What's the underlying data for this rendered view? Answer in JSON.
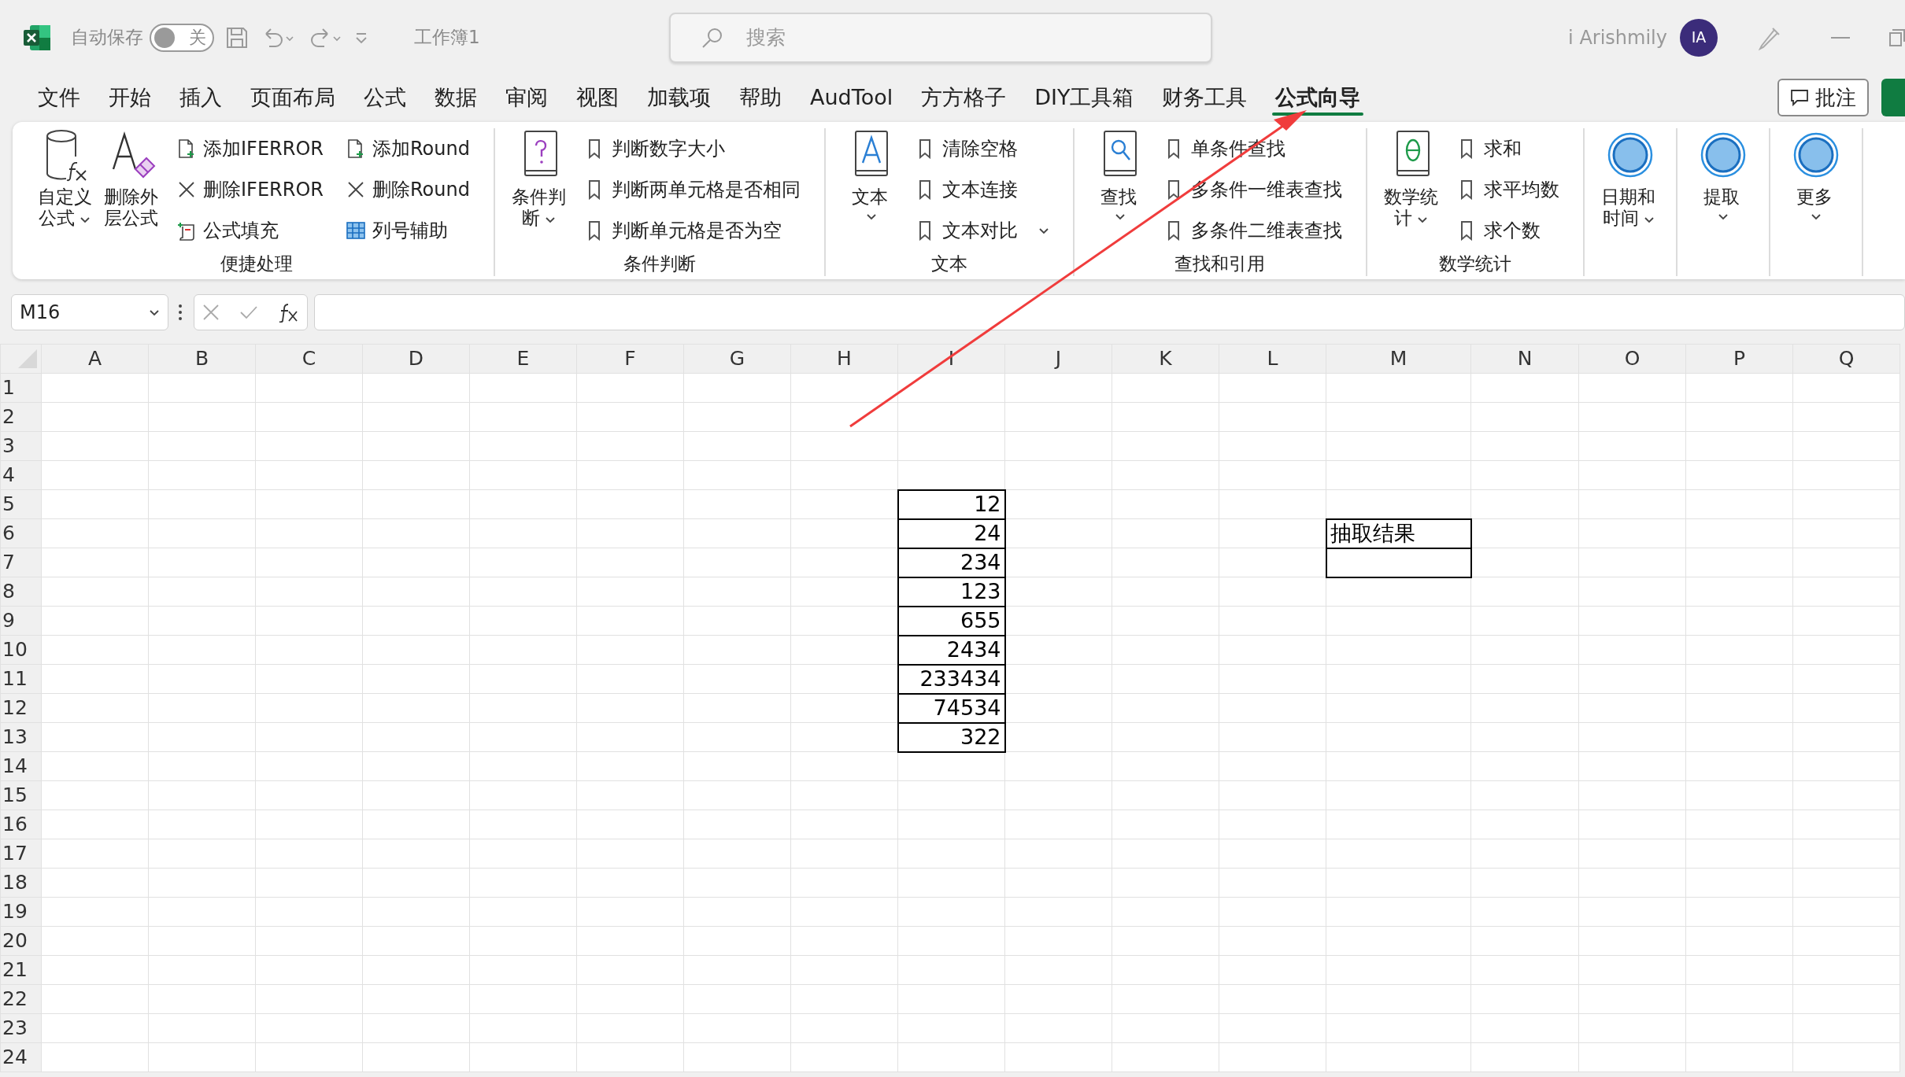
{
  "title_bar": {
    "autosave_label": "自动保存",
    "autosave": {
      "on": false,
      "label": "关"
    },
    "document_title": "工作簿1",
    "search": {
      "placeholder": "搜索"
    },
    "user_name": "i Arishmily",
    "avatar_initials": "IA"
  },
  "menu_tabs": [
    {
      "label": "文件",
      "selected": false
    },
    {
      "label": "开始",
      "selected": false
    },
    {
      "label": "插入",
      "selected": false
    },
    {
      "label": "页面布局",
      "selected": false
    },
    {
      "label": "公式",
      "selected": false
    },
    {
      "label": "数据",
      "selected": false
    },
    {
      "label": "审阅",
      "selected": false
    },
    {
      "label": "视图",
      "selected": false
    },
    {
      "label": "加载项",
      "selected": false
    },
    {
      "label": "帮助",
      "selected": false
    },
    {
      "label": "AudTool",
      "selected": false
    },
    {
      "label": "方方格子",
      "selected": false
    },
    {
      "label": "DIY工具箱",
      "selected": false
    },
    {
      "label": "财务工具",
      "selected": false
    },
    {
      "label": "公式向导",
      "selected": true
    }
  ],
  "comment_button": "批注",
  "ribbon": {
    "groups": [
      {
        "label": "便捷处理",
        "large_buttons": [
          {
            "label": "自定义公式",
            "kind": "cylinder",
            "dropdown": true
          },
          {
            "label": "删除外层公式",
            "kind": "eraser",
            "dropdown": false
          }
        ],
        "small_columns": [
          [
            {
              "label": "添加IFERROR",
              "kind": "add"
            },
            {
              "label": "删除IFERROR",
              "kind": "remove"
            },
            {
              "label": "公式填充",
              "kind": "fill"
            }
          ],
          [
            {
              "label": "添加Round",
              "kind": "add"
            },
            {
              "label": "删除Round",
              "kind": "remove"
            },
            {
              "label": "列号辅助",
              "kind": "grid"
            }
          ]
        ]
      },
      {
        "label": "条件判断",
        "large_buttons": [
          {
            "label": "条件判断",
            "kind": "question",
            "dropdown": true
          }
        ],
        "small_columns": [
          [
            {
              "label": "判断数字大小",
              "kind": "bookmark"
            },
            {
              "label": "判断两单元格是否相同",
              "kind": "bookmark"
            },
            {
              "label": "判断单元格是否为空",
              "kind": "bookmark"
            }
          ]
        ]
      },
      {
        "label": "文本",
        "large_buttons": [
          {
            "label": "文本",
            "kind": "text",
            "dropdown": true
          }
        ],
        "small_columns": [
          [
            {
              "label": "清除空格",
              "kind": "bookmark"
            },
            {
              "label": "文本连接",
              "kind": "bookmark"
            },
            {
              "label": "文本对比",
              "kind": "bookmark",
              "dropdown": true
            }
          ]
        ]
      },
      {
        "label": "查找和引用",
        "large_buttons": [
          {
            "label": "查找",
            "kind": "search",
            "dropdown": true
          }
        ],
        "small_columns": [
          [
            {
              "label": "单条件查找",
              "kind": "bookmark"
            },
            {
              "label": "多条件一维表查找",
              "kind": "bookmark"
            },
            {
              "label": "多条件二维表查找",
              "kind": "bookmark"
            }
          ]
        ]
      },
      {
        "label": "数学统计",
        "large_buttons": [
          {
            "label": "数学统计",
            "kind": "math",
            "dropdown": true
          }
        ],
        "small_columns": [
          [
            {
              "label": "求和",
              "kind": "bookmark"
            },
            {
              "label": "求平均数",
              "kind": "bookmark"
            },
            {
              "label": "求个数",
              "kind": "bookmark"
            }
          ]
        ]
      },
      {
        "large_buttons": [
          {
            "label": "日期和时间",
            "kind": "circle",
            "dropdown": true
          }
        ]
      },
      {
        "large_buttons": [
          {
            "label": "提取",
            "kind": "circle",
            "dropdown": true
          }
        ]
      },
      {
        "large_buttons": [
          {
            "label": "更多",
            "kind": "circle",
            "dropdown": true
          }
        ]
      }
    ]
  },
  "formula_bar": {
    "name_box": "M16"
  },
  "sheet": {
    "columns": [
      "A",
      "B",
      "C",
      "D",
      "E",
      "F",
      "G",
      "H",
      "I",
      "J",
      "K",
      "L",
      "M",
      "N",
      "O",
      "P",
      "Q"
    ],
    "rows": [
      {
        "number": "1"
      },
      {
        "number": "2"
      },
      {
        "number": "3"
      },
      {
        "number": "4"
      },
      {
        "number": "5",
        "cells": [
          {},
          {},
          {},
          {},
          {},
          {},
          {},
          {},
          {
            "value": "12",
            "kind": "number",
            "bordered": true
          }
        ]
      },
      {
        "number": "6",
        "cells": [
          {},
          {},
          {},
          {},
          {},
          {},
          {},
          {},
          {
            "value": "24",
            "kind": "number",
            "bordered": true
          },
          {},
          {},
          {},
          {
            "value": "抽取结果",
            "kind": "text",
            "bordered": true
          }
        ]
      },
      {
        "number": "7",
        "cells": [
          {},
          {},
          {},
          {},
          {},
          {},
          {},
          {},
          {
            "value": "234",
            "kind": "number",
            "bordered": true
          },
          {},
          {},
          {},
          {
            "bordered": true
          }
        ]
      },
      {
        "number": "8",
        "cells": [
          {},
          {},
          {},
          {},
          {},
          {},
          {},
          {},
          {
            "value": "123",
            "kind": "number",
            "bordered": true
          }
        ]
      },
      {
        "number": "9",
        "cells": [
          {},
          {},
          {},
          {},
          {},
          {},
          {},
          {},
          {
            "value": "655",
            "kind": "number",
            "bordered": true
          }
        ]
      },
      {
        "number": "10",
        "cells": [
          {},
          {},
          {},
          {},
          {},
          {},
          {},
          {},
          {
            "value": "2434",
            "kind": "number",
            "bordered": true
          }
        ]
      },
      {
        "number": "11",
        "cells": [
          {},
          {},
          {},
          {},
          {},
          {},
          {},
          {},
          {
            "value": "233434",
            "kind": "number",
            "bordered": true
          }
        ]
      },
      {
        "number": "12",
        "cells": [
          {},
          {},
          {},
          {},
          {},
          {},
          {},
          {},
          {
            "value": "74534",
            "kind": "number",
            "bordered": true
          }
        ]
      },
      {
        "number": "13",
        "cells": [
          {},
          {},
          {},
          {},
          {},
          {},
          {},
          {},
          {
            "value": "322",
            "kind": "number",
            "bordered": true
          }
        ]
      },
      {
        "number": "14"
      },
      {
        "number": "15"
      },
      {
        "number": "16"
      },
      {
        "number": "17"
      },
      {
        "number": "18"
      },
      {
        "number": "19"
      },
      {
        "number": "20"
      },
      {
        "number": "21"
      },
      {
        "number": "22"
      },
      {
        "number": "23"
      },
      {
        "number": "24"
      }
    ]
  }
}
